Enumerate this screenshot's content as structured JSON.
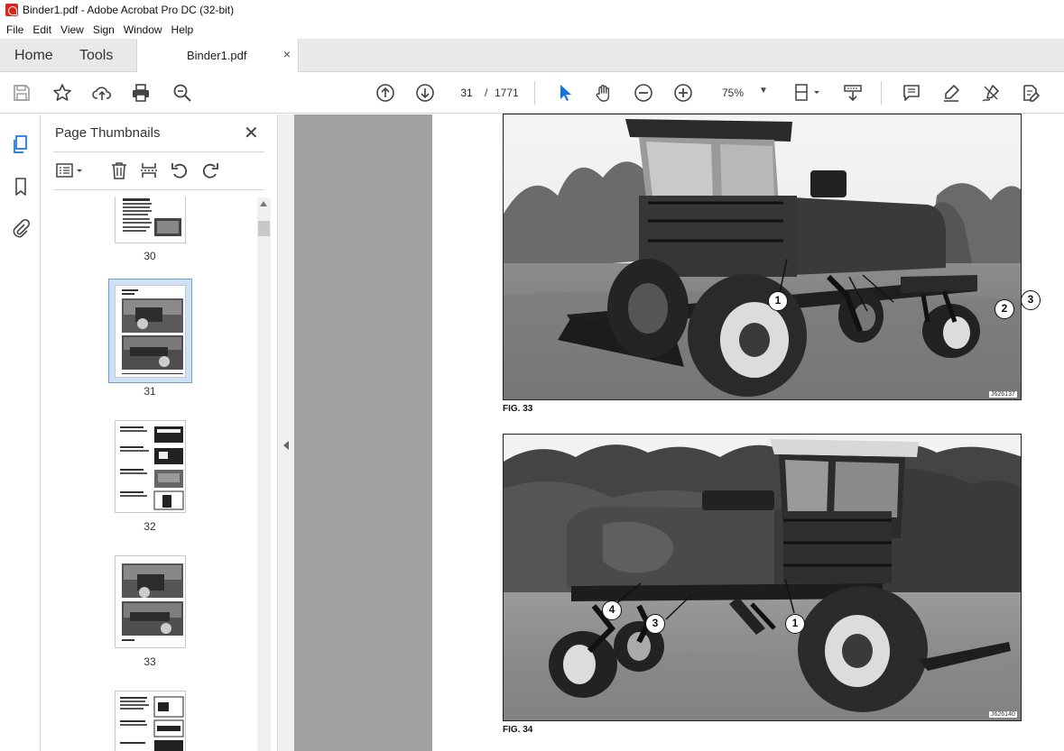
{
  "window": {
    "title": "Binder1.pdf - Adobe Acrobat Pro DC (32-bit)"
  },
  "menu": [
    "File",
    "Edit",
    "View",
    "Sign",
    "Window",
    "Help"
  ],
  "tabs": {
    "home": "Home",
    "tools": "Tools",
    "document": "Binder1.pdf",
    "close": "×"
  },
  "toolbar": {
    "page_current": "31",
    "page_separator": "/",
    "page_total": "1771",
    "zoom": "75%"
  },
  "panel": {
    "title": "Page Thumbnails",
    "close": "✕",
    "thumbnails": [
      {
        "label": "30"
      },
      {
        "label": "31",
        "selected": true
      },
      {
        "label": "32"
      },
      {
        "label": "33"
      }
    ]
  },
  "document": {
    "fig33": {
      "caption": "FIG. 33",
      "code": "J626137",
      "callouts": [
        "1",
        "2",
        "3"
      ]
    },
    "fig34": {
      "caption": "FIG. 34",
      "code": "J626140",
      "callouts": [
        "4",
        "3",
        "1"
      ]
    }
  },
  "colors": {
    "accent": "#1473e6",
    "selection_bg": "#cfe2f5",
    "canvas_bg": "#a0a0a0"
  }
}
